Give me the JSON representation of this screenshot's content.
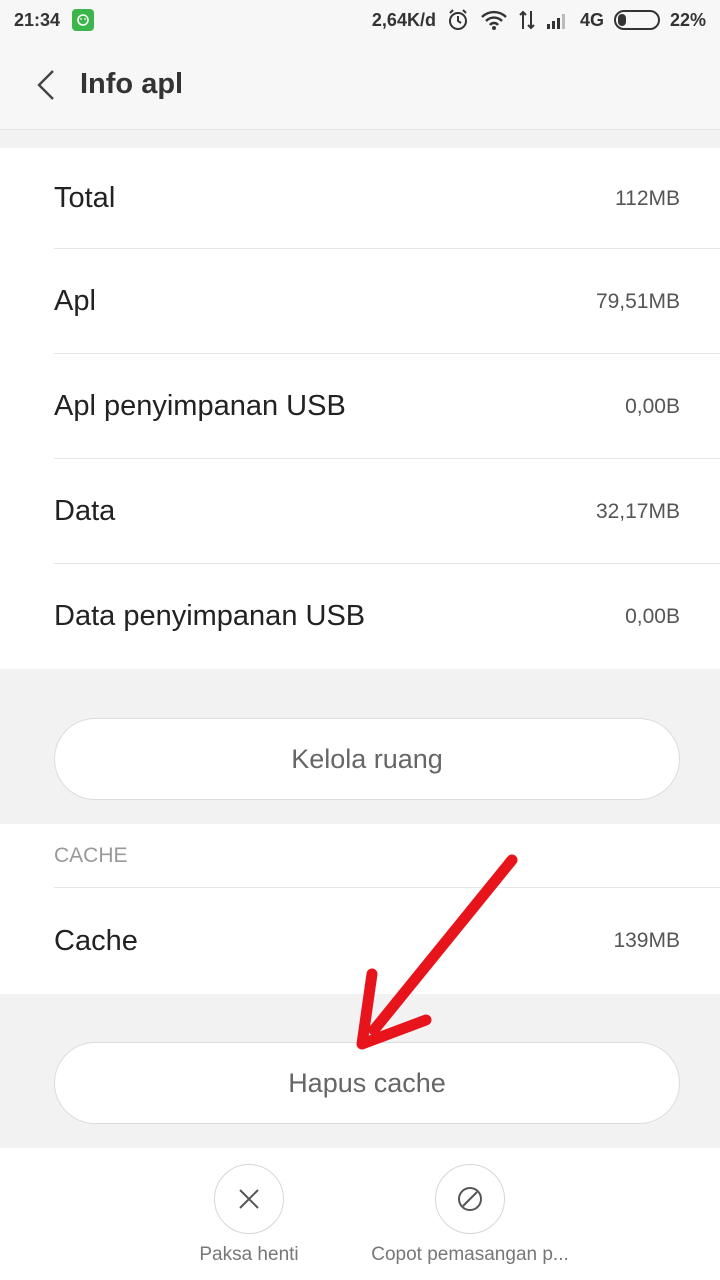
{
  "status_bar": {
    "time": "21:34",
    "network_speed": "2,64K/d",
    "network_type": "4G",
    "battery": "22%",
    "battery_level": 0.22,
    "icons": [
      "app-notification-icon",
      "alarm-icon",
      "wifi-icon",
      "data-transfer-icon",
      "signal-icon",
      "battery-icon"
    ]
  },
  "header": {
    "title": "Info apl",
    "back_icon": "chevron-left-icon"
  },
  "storage": {
    "rows": [
      {
        "label": "Total",
        "value": "112MB"
      },
      {
        "label": "Apl",
        "value": "79,51MB"
      },
      {
        "label": "Apl penyimpanan USB",
        "value": "0,00B"
      },
      {
        "label": "Data",
        "value": "32,17MB"
      },
      {
        "label": "Data penyimpanan USB",
        "value": "0,00B"
      }
    ],
    "manage_button": "Kelola ruang"
  },
  "cache": {
    "section_title": "CACHE",
    "label": "Cache",
    "value": "139MB",
    "clear_button": "Hapus cache"
  },
  "bottom_actions": [
    {
      "label": "Paksa henti",
      "icon": "close-icon"
    },
    {
      "label": "Copot pemasangan p...",
      "icon": "block-icon"
    }
  ],
  "colors": {
    "annotation_arrow": "#e8141c",
    "app_icon": "#3cb54a"
  }
}
